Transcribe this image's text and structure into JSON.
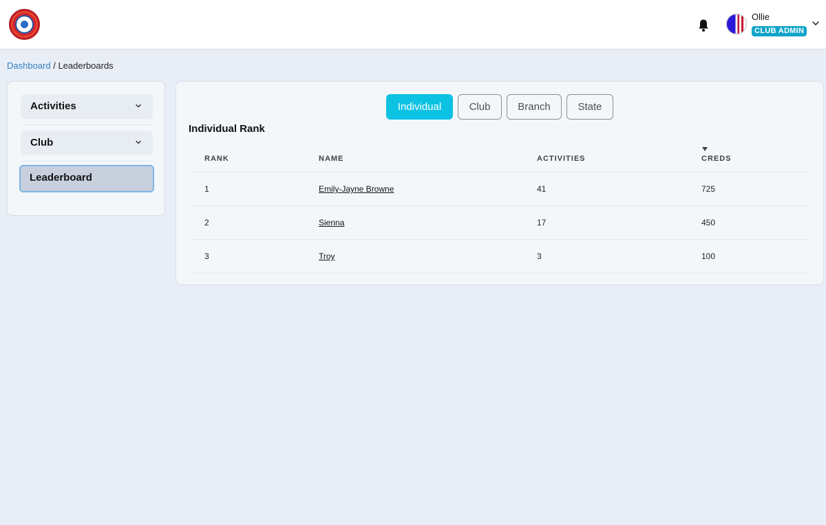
{
  "header": {
    "user_name": "Ollie",
    "role_badge": "CLUB ADMIN"
  },
  "breadcrumb": {
    "link": "Dashboard",
    "separator": " / ",
    "current": "Leaderboards"
  },
  "sidebar": {
    "items": [
      {
        "label": "Activities",
        "icon": "chevron-down-icon"
      },
      {
        "label": "Club",
        "icon": "chevron-down-icon"
      },
      {
        "label": "Leaderboard",
        "active": true
      }
    ]
  },
  "tabs": [
    {
      "label": "Individual",
      "active": true
    },
    {
      "label": "Club",
      "active": false
    },
    {
      "label": "Branch",
      "active": false
    },
    {
      "label": "State",
      "active": false
    }
  ],
  "table": {
    "title": "Individual Rank",
    "columns": [
      "RANK",
      "NAME",
      "ACTIVITIES",
      "CREDS"
    ],
    "sorted_column": "CREDS",
    "rows": [
      {
        "rank": "1",
        "name": "Emily-Jayne Browne",
        "activities": "41",
        "creds": "725"
      },
      {
        "rank": "2",
        "name": "Sienna",
        "activities": "17",
        "creds": "450"
      },
      {
        "rank": "3",
        "name": "Troy",
        "activities": "3",
        "creds": "100"
      }
    ]
  },
  "colors": {
    "accent": "#0bc2e3",
    "badge": "#12a4c8",
    "link": "#2f7fc4",
    "background": "#e9eef6"
  },
  "icons": [
    "logo",
    "bell-icon",
    "avatar",
    "chevron-down-icon",
    "sort-descending-icon"
  ]
}
